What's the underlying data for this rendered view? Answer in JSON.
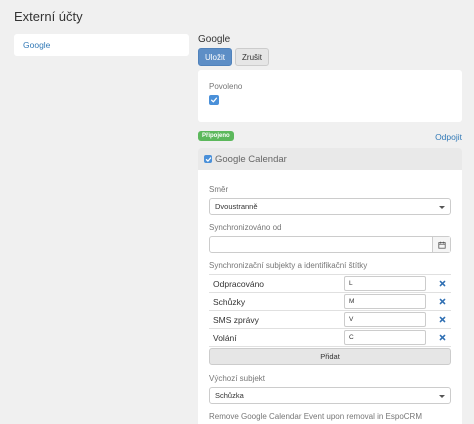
{
  "page": {
    "title": "Externí účty"
  },
  "sidebar": {
    "items": [
      {
        "label": "Google"
      }
    ]
  },
  "record": {
    "title": "Google"
  },
  "buttons": {
    "save": "Uložit",
    "cancel": "Zrušit"
  },
  "enabled": {
    "label": "Povoleno",
    "checked": true
  },
  "status": {
    "connected_badge": "Připojeno",
    "disconnect": "Odpojit"
  },
  "calendar": {
    "header_label": "Google Calendar",
    "direction": {
      "label": "Směr",
      "value": "Dvoustranně"
    },
    "sync_since": {
      "label": "Synchronizováno od",
      "value": ""
    },
    "mapping": {
      "label": "Synchronizační subjekty a identifikační štítky",
      "rows": [
        {
          "name": "Odpracováno",
          "code": "L"
        },
        {
          "name": "Schůzky",
          "code": "M"
        },
        {
          "name": "SMS zprávy",
          "code": "V"
        },
        {
          "name": "Volání",
          "code": "C"
        }
      ],
      "add_label": "Přidat"
    },
    "default_entity": {
      "label": "Výchozí subjekt",
      "value": "Schůzka"
    },
    "remove_on_delete": {
      "label": "Remove Google Calendar Event upon removal in EspoCRM",
      "checked": false
    }
  },
  "colors": {
    "primary": "#5d8ec6",
    "link": "#337ab7",
    "success": "#5cb85c",
    "remove": "#2f6fb3"
  }
}
